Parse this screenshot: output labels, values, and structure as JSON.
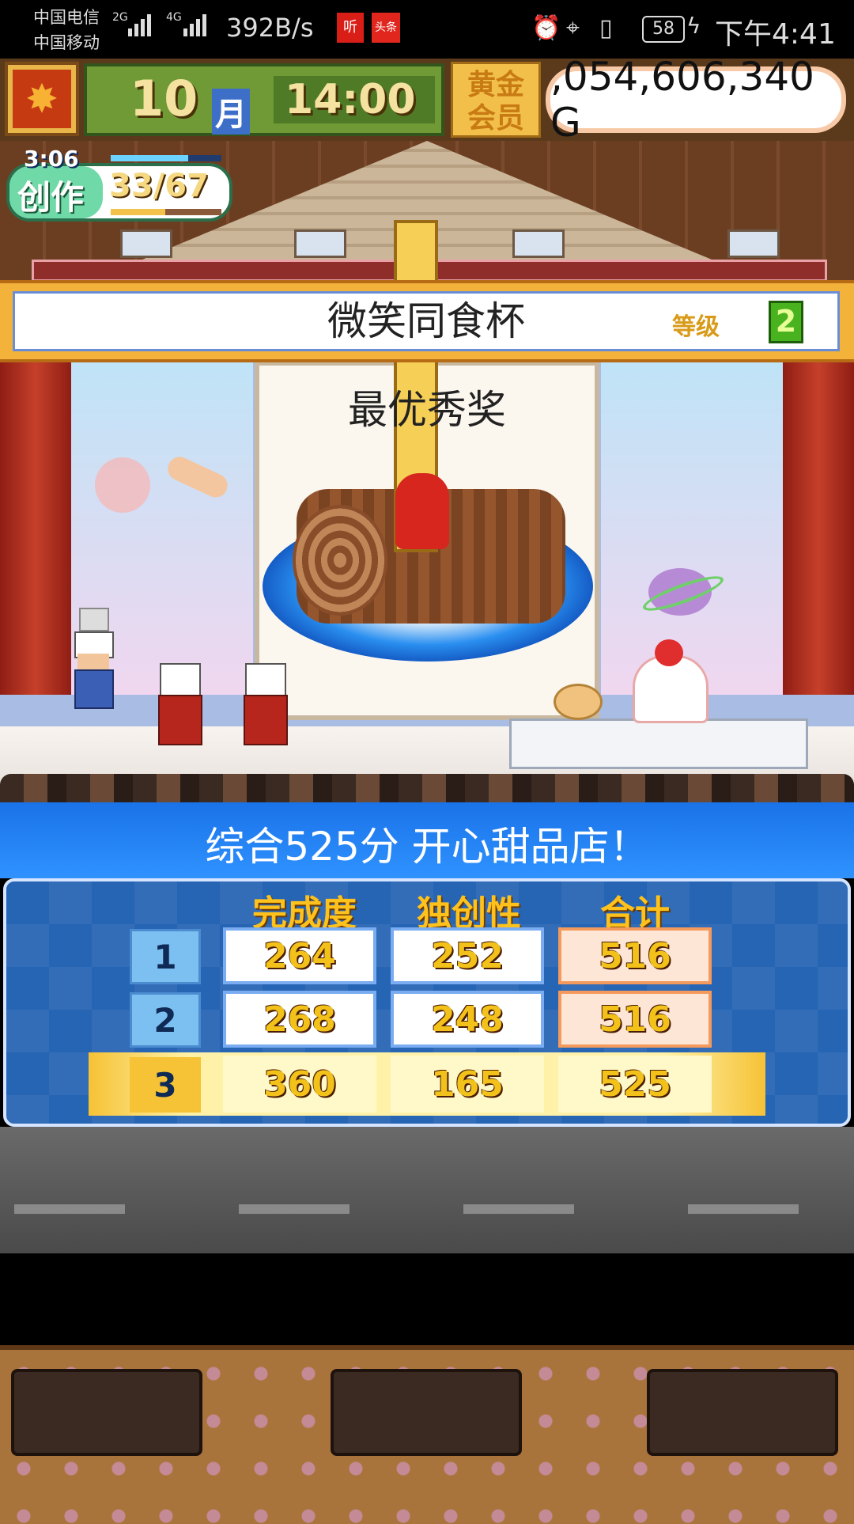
{
  "status_bar": {
    "carrier1": "中国电信",
    "carrier2": "中国移动",
    "net1": "2G",
    "net2": "4G",
    "speed": "392B/s",
    "app_icon1": "听",
    "app_icon2": "头条",
    "battery": "58",
    "time": "下午4:41"
  },
  "top_bar": {
    "month": "10",
    "month_unit": "月",
    "clock": "14:00",
    "member_label": "黄金会员",
    "money": ",054,606,340 G"
  },
  "create_badge": {
    "timer": "3:06",
    "label": "创作",
    "progress_text": "33/67",
    "timer_fill": 0.7,
    "progress_fill": 0.49
  },
  "contest": {
    "name": "微笑同食杯",
    "grade_label": "等级",
    "grade_value": "2",
    "award": "最优秀奖"
  },
  "summary": "综合525分 开心甜品店！",
  "scoreboard": {
    "headers": [
      "完成度",
      "独创性",
      "合计"
    ],
    "rows": [
      {
        "rank": "1",
        "completion": "264",
        "originality": "252",
        "total": "516"
      },
      {
        "rank": "2",
        "completion": "268",
        "originality": "248",
        "total": "516"
      },
      {
        "rank": "3",
        "completion": "360",
        "originality": "165",
        "total": "525"
      }
    ]
  },
  "colors": {
    "summary_blue": "#1a73e8",
    "board_blue": "#2664b4",
    "score_gold": "#f3c21a",
    "highlight": "#fff2a8"
  }
}
